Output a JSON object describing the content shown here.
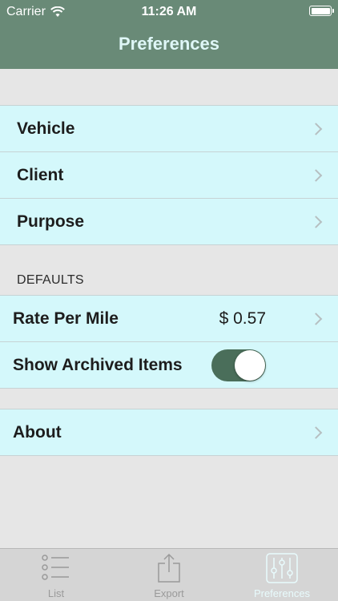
{
  "status": {
    "carrier": "Carrier",
    "time": "11:26 AM"
  },
  "nav": {
    "title": "Preferences"
  },
  "menu_group_1": {
    "items": [
      {
        "label": "Vehicle"
      },
      {
        "label": "Client"
      },
      {
        "label": "Purpose"
      }
    ]
  },
  "defaults": {
    "header": "DEFAULTS",
    "rate_label": "Rate Per Mile",
    "rate_value": "$ 0.57",
    "archived_label": "Show Archived Items",
    "archived_on": true
  },
  "about": {
    "label": "About"
  },
  "tabbar": {
    "tabs": [
      {
        "label": "List",
        "icon": "list-icon"
      },
      {
        "label": "Export",
        "icon": "share-icon"
      },
      {
        "label": "Preferences",
        "icon": "sliders-icon"
      }
    ],
    "active": 2
  },
  "colors": {
    "header_bg": "#698a77",
    "cell_bg": "#d4f8fb",
    "page_bg": "#e6e6e6",
    "toggle_on": "#4a6e5a",
    "tab_active": "#e8fbfd"
  }
}
